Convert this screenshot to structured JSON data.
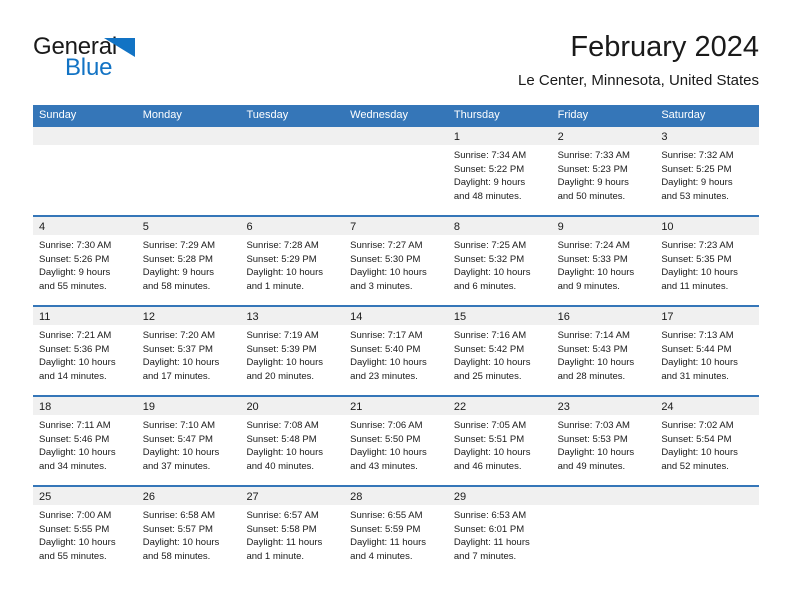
{
  "brand": {
    "name_part1": "General",
    "name_part2": "Blue",
    "triangle_icon": "triangle-icon",
    "accent_color": "#1273c4"
  },
  "header": {
    "title": "February 2024",
    "subtitle": "Le Center, Minnesota, United States"
  },
  "theme": {
    "header_blue": "#3576b8",
    "day_band_gray": "#f0f0f0",
    "text_color": "#1a1a1a"
  },
  "calendar": {
    "day_headers": [
      "Sunday",
      "Monday",
      "Tuesday",
      "Wednesday",
      "Thursday",
      "Friday",
      "Saturday"
    ],
    "weeks": [
      [
        {
          "day": "",
          "lines": []
        },
        {
          "day": "",
          "lines": []
        },
        {
          "day": "",
          "lines": []
        },
        {
          "day": "",
          "lines": []
        },
        {
          "day": "1",
          "lines": [
            "Sunrise: 7:34 AM",
            "Sunset: 5:22 PM",
            "Daylight: 9 hours",
            "and 48 minutes."
          ]
        },
        {
          "day": "2",
          "lines": [
            "Sunrise: 7:33 AM",
            "Sunset: 5:23 PM",
            "Daylight: 9 hours",
            "and 50 minutes."
          ]
        },
        {
          "day": "3",
          "lines": [
            "Sunrise: 7:32 AM",
            "Sunset: 5:25 PM",
            "Daylight: 9 hours",
            "and 53 minutes."
          ]
        }
      ],
      [
        {
          "day": "4",
          "lines": [
            "Sunrise: 7:30 AM",
            "Sunset: 5:26 PM",
            "Daylight: 9 hours",
            "and 55 minutes."
          ]
        },
        {
          "day": "5",
          "lines": [
            "Sunrise: 7:29 AM",
            "Sunset: 5:28 PM",
            "Daylight: 9 hours",
            "and 58 minutes."
          ]
        },
        {
          "day": "6",
          "lines": [
            "Sunrise: 7:28 AM",
            "Sunset: 5:29 PM",
            "Daylight: 10 hours",
            "and 1 minute."
          ]
        },
        {
          "day": "7",
          "lines": [
            "Sunrise: 7:27 AM",
            "Sunset: 5:30 PM",
            "Daylight: 10 hours",
            "and 3 minutes."
          ]
        },
        {
          "day": "8",
          "lines": [
            "Sunrise: 7:25 AM",
            "Sunset: 5:32 PM",
            "Daylight: 10 hours",
            "and 6 minutes."
          ]
        },
        {
          "day": "9",
          "lines": [
            "Sunrise: 7:24 AM",
            "Sunset: 5:33 PM",
            "Daylight: 10 hours",
            "and 9 minutes."
          ]
        },
        {
          "day": "10",
          "lines": [
            "Sunrise: 7:23 AM",
            "Sunset: 5:35 PM",
            "Daylight: 10 hours",
            "and 11 minutes."
          ]
        }
      ],
      [
        {
          "day": "11",
          "lines": [
            "Sunrise: 7:21 AM",
            "Sunset: 5:36 PM",
            "Daylight: 10 hours",
            "and 14 minutes."
          ]
        },
        {
          "day": "12",
          "lines": [
            "Sunrise: 7:20 AM",
            "Sunset: 5:37 PM",
            "Daylight: 10 hours",
            "and 17 minutes."
          ]
        },
        {
          "day": "13",
          "lines": [
            "Sunrise: 7:19 AM",
            "Sunset: 5:39 PM",
            "Daylight: 10 hours",
            "and 20 minutes."
          ]
        },
        {
          "day": "14",
          "lines": [
            "Sunrise: 7:17 AM",
            "Sunset: 5:40 PM",
            "Daylight: 10 hours",
            "and 23 minutes."
          ]
        },
        {
          "day": "15",
          "lines": [
            "Sunrise: 7:16 AM",
            "Sunset: 5:42 PM",
            "Daylight: 10 hours",
            "and 25 minutes."
          ]
        },
        {
          "day": "16",
          "lines": [
            "Sunrise: 7:14 AM",
            "Sunset: 5:43 PM",
            "Daylight: 10 hours",
            "and 28 minutes."
          ]
        },
        {
          "day": "17",
          "lines": [
            "Sunrise: 7:13 AM",
            "Sunset: 5:44 PM",
            "Daylight: 10 hours",
            "and 31 minutes."
          ]
        }
      ],
      [
        {
          "day": "18",
          "lines": [
            "Sunrise: 7:11 AM",
            "Sunset: 5:46 PM",
            "Daylight: 10 hours",
            "and 34 minutes."
          ]
        },
        {
          "day": "19",
          "lines": [
            "Sunrise: 7:10 AM",
            "Sunset: 5:47 PM",
            "Daylight: 10 hours",
            "and 37 minutes."
          ]
        },
        {
          "day": "20",
          "lines": [
            "Sunrise: 7:08 AM",
            "Sunset: 5:48 PM",
            "Daylight: 10 hours",
            "and 40 minutes."
          ]
        },
        {
          "day": "21",
          "lines": [
            "Sunrise: 7:06 AM",
            "Sunset: 5:50 PM",
            "Daylight: 10 hours",
            "and 43 minutes."
          ]
        },
        {
          "day": "22",
          "lines": [
            "Sunrise: 7:05 AM",
            "Sunset: 5:51 PM",
            "Daylight: 10 hours",
            "and 46 minutes."
          ]
        },
        {
          "day": "23",
          "lines": [
            "Sunrise: 7:03 AM",
            "Sunset: 5:53 PM",
            "Daylight: 10 hours",
            "and 49 minutes."
          ]
        },
        {
          "day": "24",
          "lines": [
            "Sunrise: 7:02 AM",
            "Sunset: 5:54 PM",
            "Daylight: 10 hours",
            "and 52 minutes."
          ]
        }
      ],
      [
        {
          "day": "25",
          "lines": [
            "Sunrise: 7:00 AM",
            "Sunset: 5:55 PM",
            "Daylight: 10 hours",
            "and 55 minutes."
          ]
        },
        {
          "day": "26",
          "lines": [
            "Sunrise: 6:58 AM",
            "Sunset: 5:57 PM",
            "Daylight: 10 hours",
            "and 58 minutes."
          ]
        },
        {
          "day": "27",
          "lines": [
            "Sunrise: 6:57 AM",
            "Sunset: 5:58 PM",
            "Daylight: 11 hours",
            "and 1 minute."
          ]
        },
        {
          "day": "28",
          "lines": [
            "Sunrise: 6:55 AM",
            "Sunset: 5:59 PM",
            "Daylight: 11 hours",
            "and 4 minutes."
          ]
        },
        {
          "day": "29",
          "lines": [
            "Sunrise: 6:53 AM",
            "Sunset: 6:01 PM",
            "Daylight: 11 hours",
            "and 7 minutes."
          ]
        },
        {
          "day": "",
          "lines": []
        },
        {
          "day": "",
          "lines": []
        }
      ]
    ]
  }
}
